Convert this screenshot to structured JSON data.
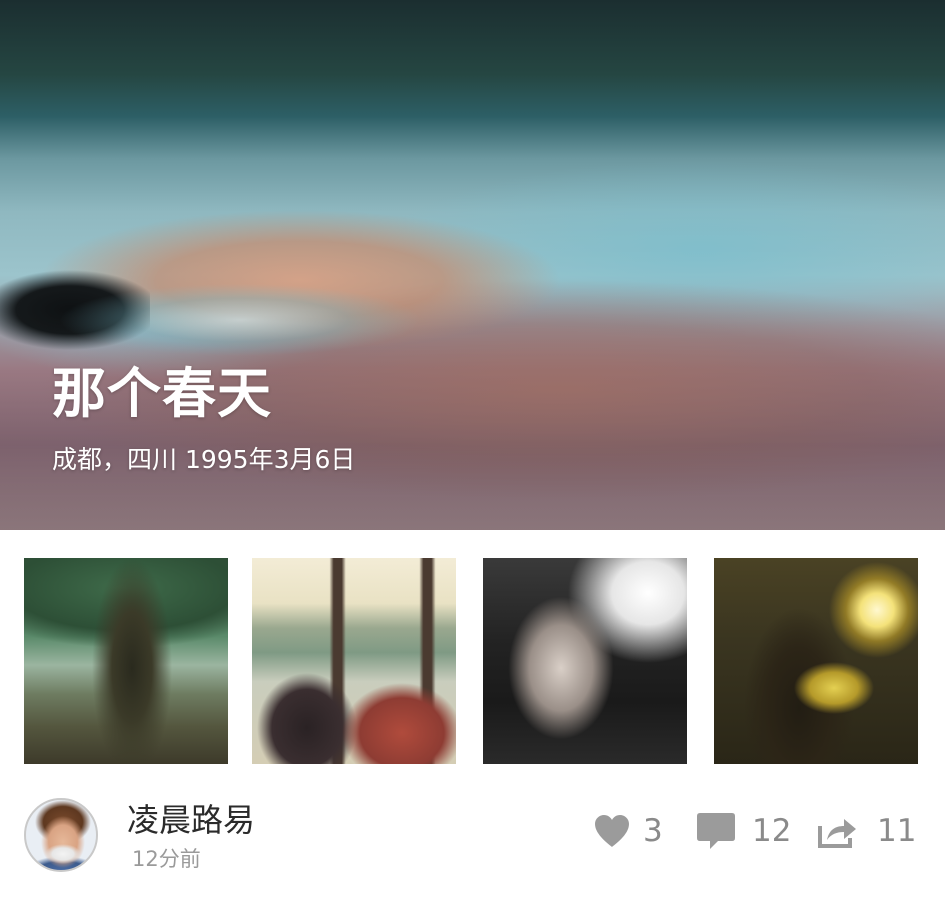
{
  "hero": {
    "title": "那个春天",
    "subtitle": "成都，四川 1995年3月6日"
  },
  "thumbnails": [
    {
      "icon": "photo-trees"
    },
    {
      "icon": "photo-two-people-lake"
    },
    {
      "icon": "photo-portrait-bw"
    },
    {
      "icon": "photo-sunlight-silhouette"
    }
  ],
  "author": {
    "name": "凌晨路易",
    "time": "12分前"
  },
  "stats": {
    "likes": "3",
    "comments": "12",
    "shares": "11"
  },
  "colors": {
    "icon_gray": "#9b9b9b",
    "count_gray": "#8a8a8a",
    "name_text": "#2b2b2b"
  }
}
